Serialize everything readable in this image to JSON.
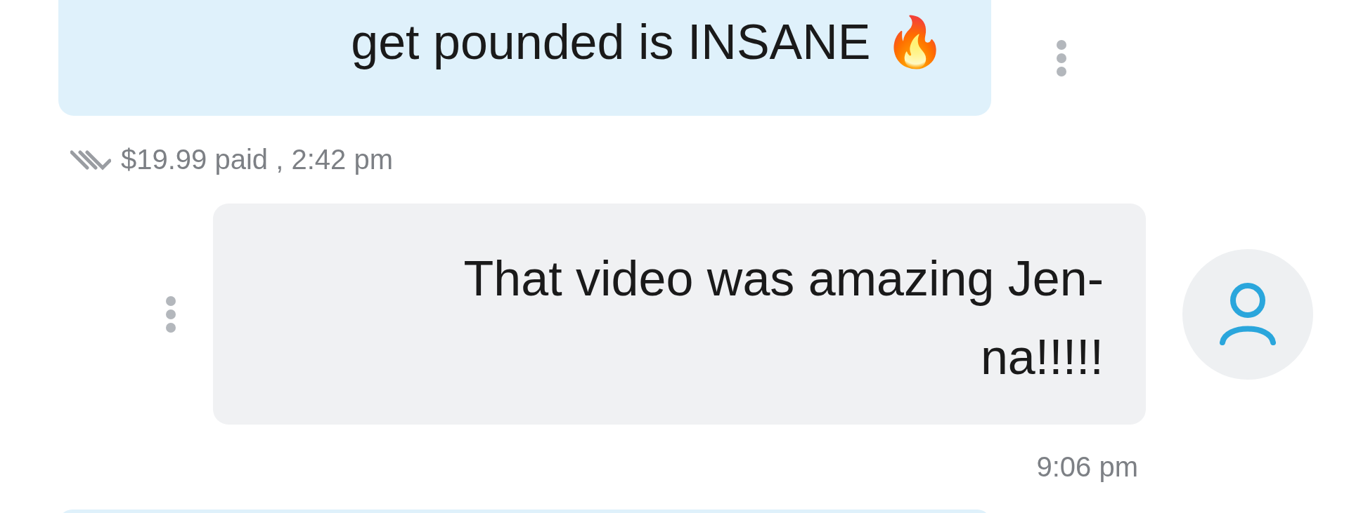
{
  "messages": [
    {
      "kind": "outgoing",
      "lines": [
        "get pounded is INSANE 🔥"
      ],
      "meta": "$19.99 paid , 2:42 pm",
      "read": true
    },
    {
      "kind": "incoming",
      "lines": [
        "That video was amazing Jen-",
        "na!!!!!"
      ],
      "meta": "9:06 pm"
    },
    {
      "kind": "outgoing"
    }
  ]
}
